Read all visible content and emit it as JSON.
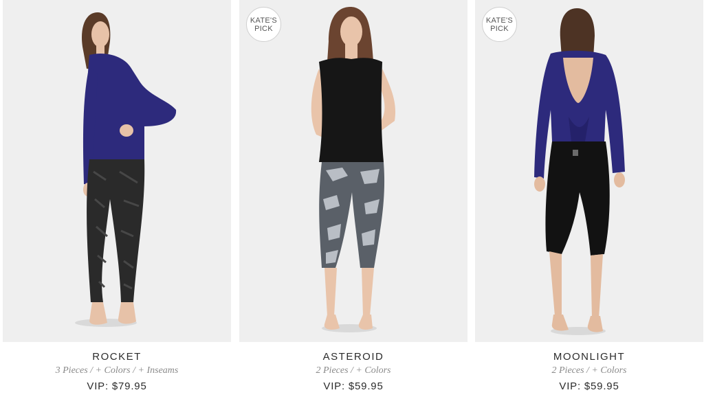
{
  "products": [
    {
      "name": "ROCKET",
      "badge": "",
      "details": {
        "pieces": "3 Pieces",
        "colors": "+ Colors",
        "inseams": "+ Inseams",
        "sep": "/"
      },
      "price": "VIP: $79.95",
      "colors": {
        "top": "#2d2a7c",
        "bottom": "#2a2a2a",
        "pattern": "#474747",
        "skin": "#e7c2a8",
        "hair": "#5a3b28",
        "bg": "#efefef"
      }
    },
    {
      "name": "ASTEROID",
      "badge": "KATE'S PICK",
      "details": {
        "pieces": "2 Pieces",
        "colors": "+ Colors",
        "sep": "/"
      },
      "price": "VIP: $59.95",
      "colors": {
        "top": "#161616",
        "bottom": "#5a6068",
        "pattern": "#b9bec5",
        "skin": "#e9c4aa",
        "hair": "#6b4430",
        "bg": "#efefef"
      }
    },
    {
      "name": "MOONLIGHT",
      "badge": "KATE'S PICK",
      "details": {
        "pieces": "2 Pieces",
        "colors": "+ Colors",
        "sep": "/"
      },
      "price": "VIP: $59.95",
      "colors": {
        "top": "#2d2a7c",
        "bottom": "#121212",
        "skin": "#e3bb9f",
        "hair": "#4d3324",
        "bg": "#efefef"
      }
    }
  ]
}
